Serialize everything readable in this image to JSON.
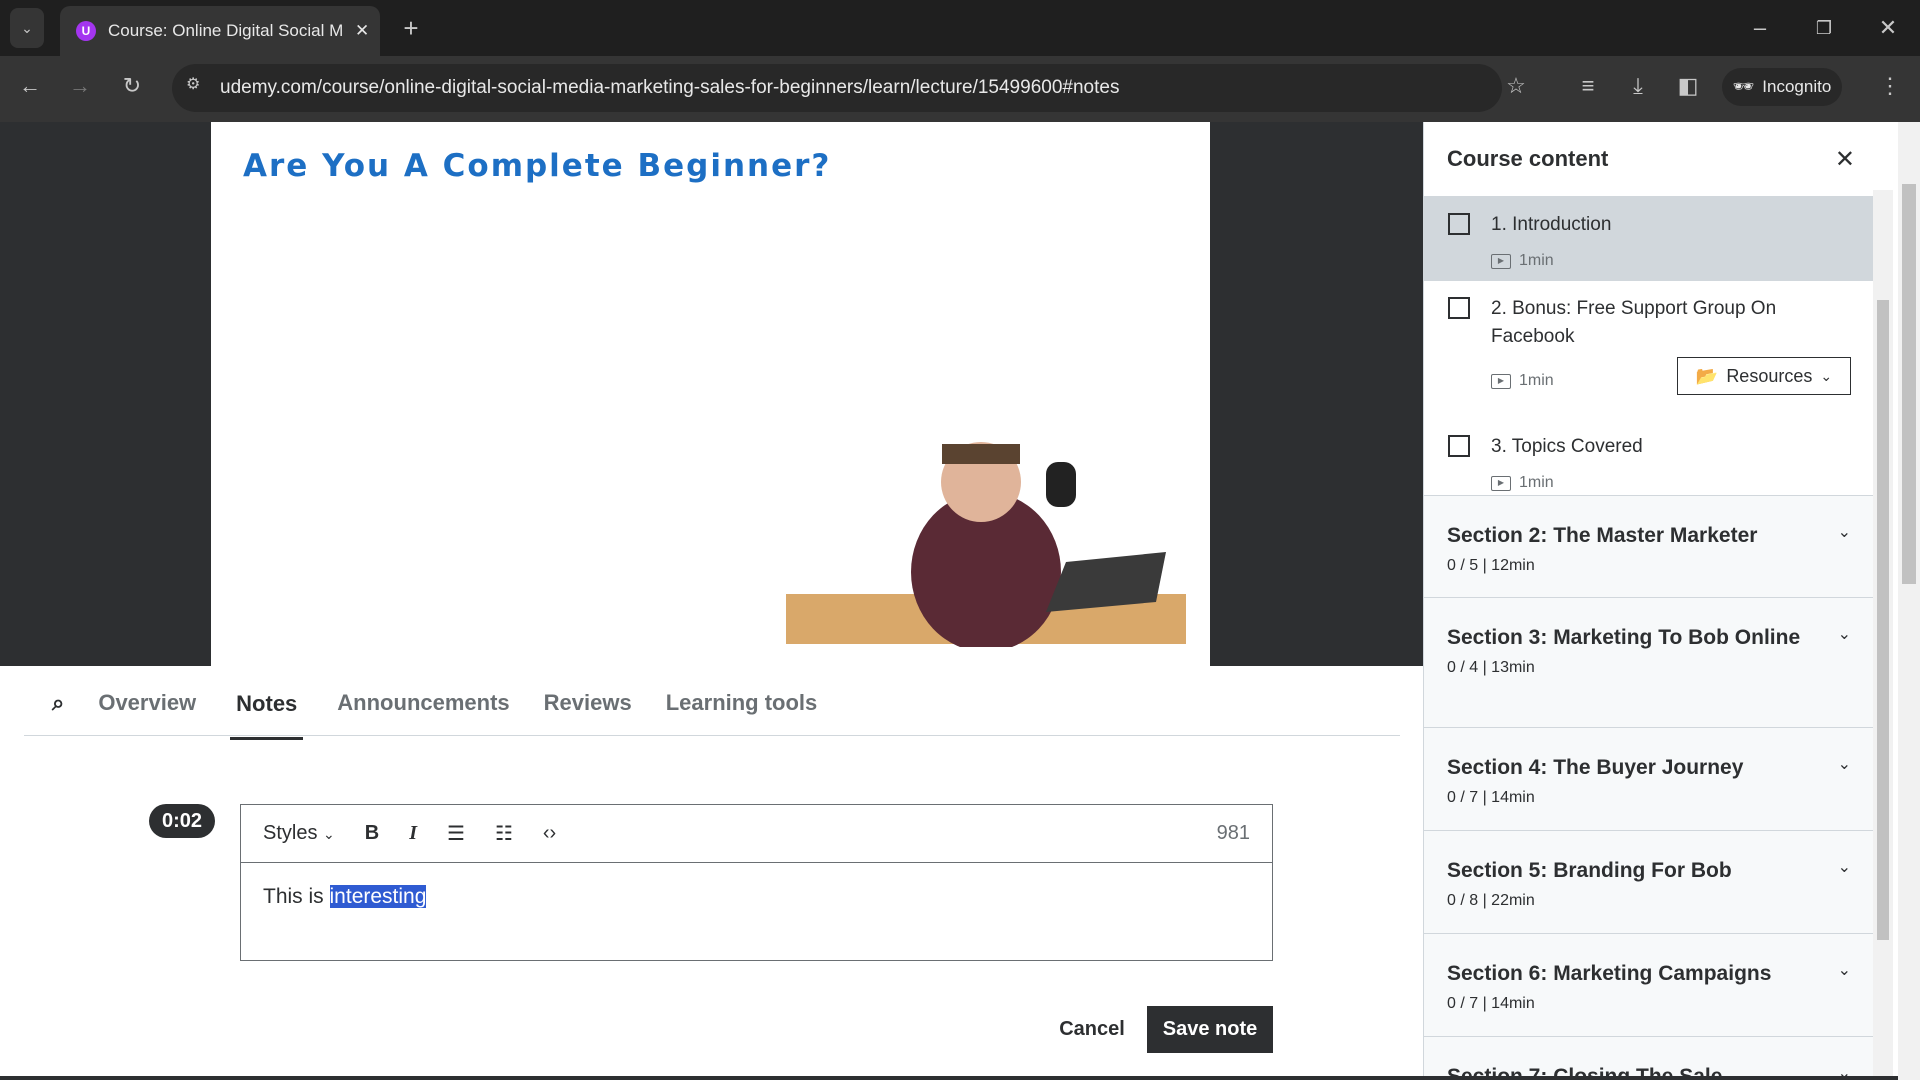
{
  "browser": {
    "tab_title": "Course: Online Digital Social M",
    "url": "udemy.com/course/online-digital-social-media-marketing-sales-for-beginners/learn/lecture/15499600#notes",
    "profile": "Incognito"
  },
  "video": {
    "slide_title": "Are You A Complete Beginner?"
  },
  "tabs": [
    "Overview",
    "Notes",
    "Announcements",
    "Reviews",
    "Learning tools"
  ],
  "active_tab": "Notes",
  "note": {
    "timestamp": "0:02",
    "styles_label": "Styles",
    "char_count": "981",
    "text_before": "This is ",
    "text_selected": "interesting",
    "cancel": "Cancel",
    "save": "Save note"
  },
  "sidebar": {
    "title": "Course content",
    "resources_label": "Resources",
    "lectures": [
      {
        "title": "1. Introduction",
        "duration": "1min"
      },
      {
        "title": "2. Bonus: Free Support Group On Facebook",
        "duration": "1min"
      },
      {
        "title": "3. Topics Covered",
        "duration": "1min"
      }
    ],
    "sections": [
      {
        "title": "Section 2: The Master Marketer",
        "meta": "0 / 5 | 12min"
      },
      {
        "title": "Section 3: Marketing To Bob Online",
        "meta": "0 / 4 | 13min"
      },
      {
        "title": "Section 4: The Buyer Journey",
        "meta": "0 / 7 | 14min"
      },
      {
        "title": "Section 5: Branding For Bob",
        "meta": "0 / 8 | 22min"
      },
      {
        "title": "Section 6: Marketing Campaigns",
        "meta": "0 / 7 | 14min"
      },
      {
        "title": "Section 7: Closing The Sale",
        "meta": ""
      }
    ]
  }
}
